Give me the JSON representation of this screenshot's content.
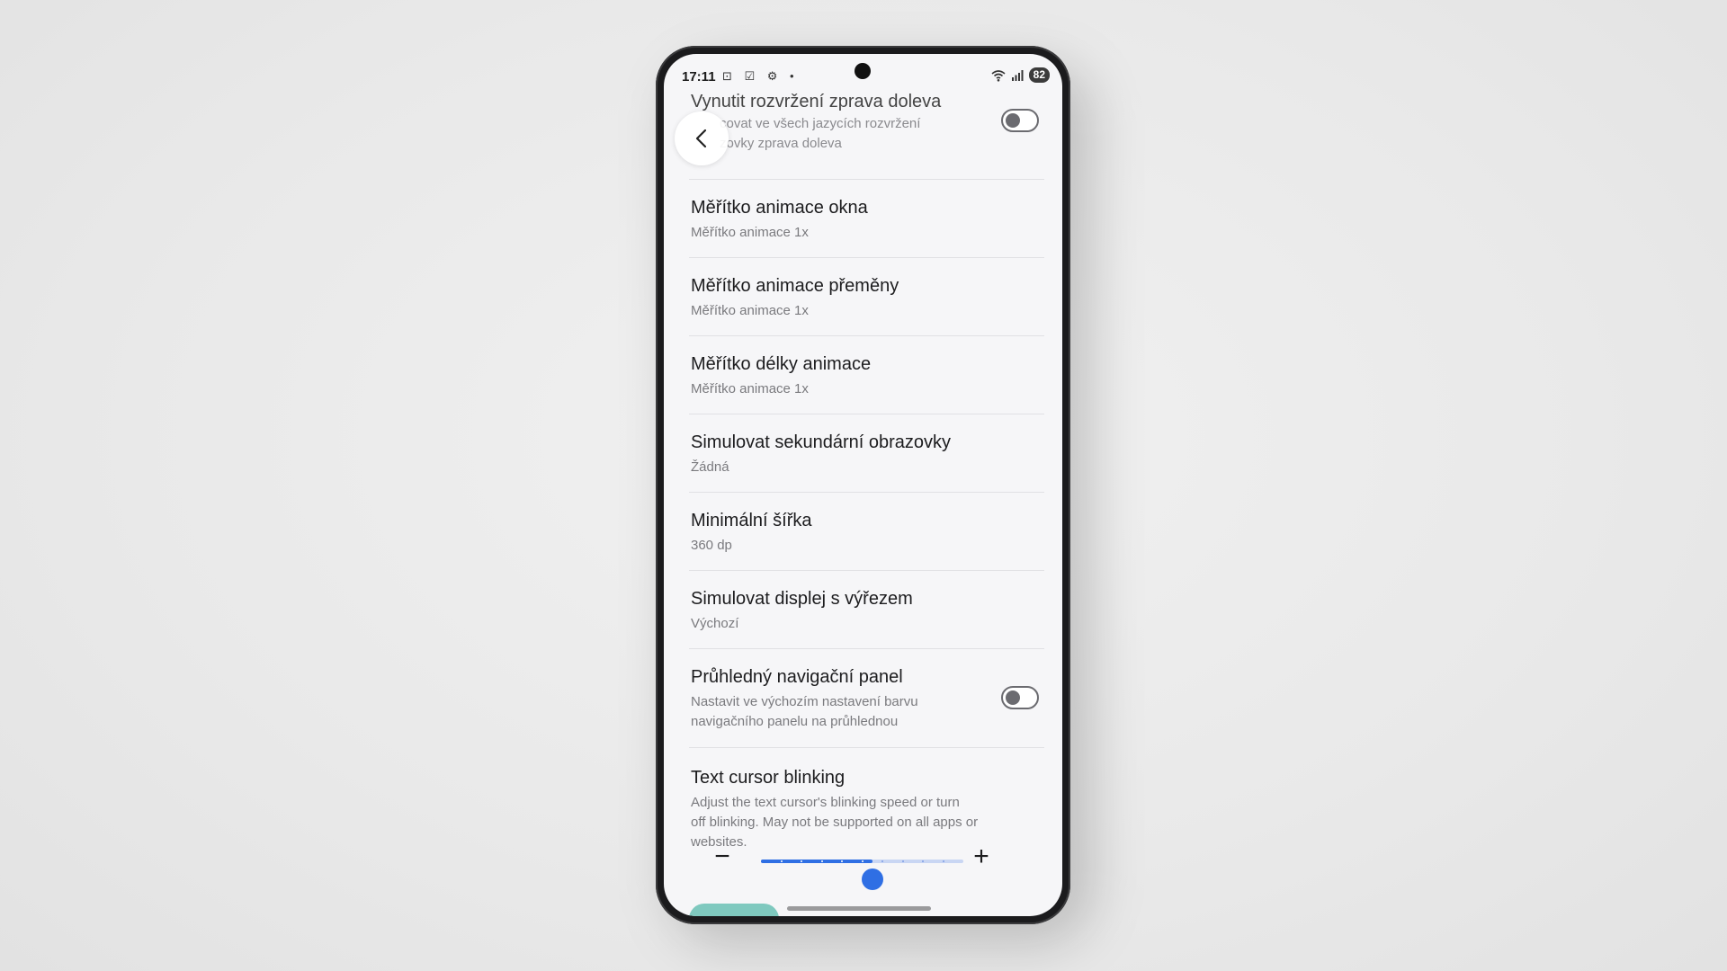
{
  "status_bar": {
    "time": "17:11",
    "notification_icons": "⊡ ☑ ⚙ •",
    "battery": "82"
  },
  "settings": [
    {
      "title": "Vynutit rozvržení zprava doleva",
      "subtitle": "covat ve všech jazycích rozvržení",
      "subtitle2": "zovky zprava doleva",
      "toggle": "off"
    },
    {
      "title": "Měřítko animace okna",
      "subtitle": "Měřítko animace 1x"
    },
    {
      "title": "Měřítko animace přeměny",
      "subtitle": "Měřítko animace 1x"
    },
    {
      "title": "Měřítko délky animace",
      "subtitle": "Měřítko animace 1x"
    },
    {
      "title": "Simulovat sekundární obrazovky",
      "subtitle": "Žádná"
    },
    {
      "title": "Minimální šířka",
      "subtitle": "360 dp"
    },
    {
      "title": "Simulovat displej s výřezem",
      "subtitle": "Výchozí"
    },
    {
      "title": "Průhledný navigační panel",
      "subtitle": "Nastavit ve výchozím nastavení barvu",
      "subtitle2": "navigačního panelu na průhlednou",
      "toggle": "off"
    },
    {
      "title": "Text cursor blinking",
      "subtitle": "Adjust the text cursor's blinking speed or turn",
      "subtitle2": "off blinking. May not be supported on all apps or",
      "subtitle3": "websites."
    }
  ],
  "slider": {
    "minus_label": "−",
    "plus_label": "+",
    "value_fraction": 0.55,
    "steps": 11
  },
  "colors": {
    "accent": "#2f6fe4",
    "toggle_off": "#6b6b70"
  },
  "icons": {
    "back": "chevron-left-icon"
  }
}
